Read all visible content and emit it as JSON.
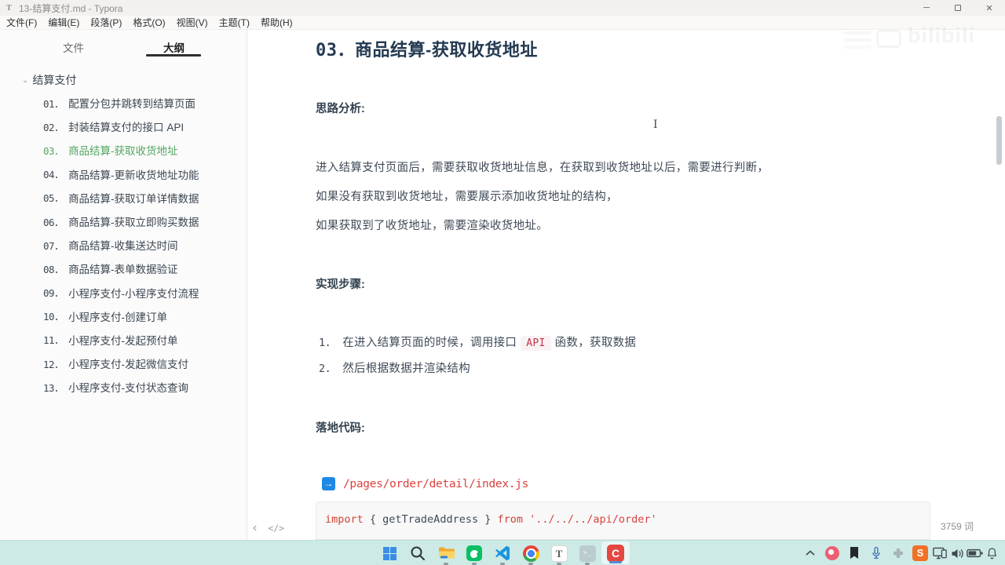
{
  "window": {
    "app_initial": "T",
    "title": "13-结算支付.md - Typora",
    "controls": {
      "minimize": "─",
      "close": "✕"
    }
  },
  "menu_bar": {
    "items": [
      {
        "label": "文件(F)"
      },
      {
        "label": "编辑(E)"
      },
      {
        "label": "段落(P)"
      },
      {
        "label": "格式(O)"
      },
      {
        "label": "视图(V)"
      },
      {
        "label": "主题(T)"
      },
      {
        "label": "帮助(H)"
      }
    ]
  },
  "sidebar": {
    "tabs": {
      "files": "文件",
      "outline": "大纲"
    },
    "active_tab": "大纲",
    "root": "结算支付",
    "root_chevron": "⌄",
    "items": [
      {
        "num": "01．",
        "label": "配置分包并跳转到结算页面"
      },
      {
        "num": "02．",
        "label": "封装结算支付的接口 API"
      },
      {
        "num": "03．",
        "label": "商品结算-获取收货地址"
      },
      {
        "num": "04．",
        "label": "商品结算-更新收货地址功能"
      },
      {
        "num": "05．",
        "label": "商品结算-获取订单详情数据"
      },
      {
        "num": "06．",
        "label": "商品结算-获取立即购买数据"
      },
      {
        "num": "07．",
        "label": "商品结算-收集送达时间"
      },
      {
        "num": "08．",
        "label": "商品结算-表单数据验证"
      },
      {
        "num": "09．",
        "label": "小程序支付-小程序支付流程"
      },
      {
        "num": "10．",
        "label": "小程序支付-创建订单"
      },
      {
        "num": "11．",
        "label": "小程序支付-发起预付单"
      },
      {
        "num": "12．",
        "label": "小程序支付-发起微信支付"
      },
      {
        "num": "13．",
        "label": "小程序支付-支付状态查询"
      }
    ],
    "active_index": 2
  },
  "document": {
    "heading_num": "03．",
    "heading_text": "商品结算-获取收货地址",
    "label_analysis": "思路分析:",
    "paragraphs": [
      "进入结算支付页面后，需要获取收货地址信息，在获取到收货地址以后，需要进行判断，",
      "如果没有获取到收货地址，需要展示添加收货地址的结构，",
      "如果获取到了收货地址，需要渲染收货地址。"
    ],
    "label_steps": "实现步骤:",
    "step1": {
      "num": "1．",
      "pre": "在进入结算页面的时候，调用接口",
      "code": "API",
      "post": "函数，获取数据"
    },
    "step2": {
      "num": "2．",
      "text": "然后根据数据并渲染结构"
    },
    "label_code": "落地代码:",
    "arrow_glyph": "→",
    "file_path": "/pages/order/detail/index.js",
    "code_tokens": {
      "kw1": "import",
      "plain": " { getTradeAddress } ",
      "kw2": "from",
      "str": " '../../../api/order'"
    },
    "footer": {
      "back_glyph": "‹",
      "source_mode_glyph": "</>",
      "word_count": "3759 词"
    },
    "watermark": "bilibili"
  },
  "taskbar": {
    "icons": [
      "windows-start",
      "search",
      "file-explorer",
      "wechat-devtools",
      "vscode",
      "chrome",
      "typora",
      "terminal",
      "screen-recorder-c"
    ],
    "typora_letter": "T",
    "terminal_glyph": ">_",
    "c_letter": "C",
    "tray": {
      "s_letter": "S",
      "icons": [
        "tray-expand",
        "red-app",
        "bookmark-app",
        "microphone",
        "gray-app",
        "sogou-input",
        "cast-display",
        "volume",
        "battery",
        "notification-bell"
      ]
    }
  },
  "colors": {
    "accent_green": "#55a561",
    "inline_code_red": "#c7344a",
    "path_red": "#d9433e",
    "arrow_blue": "#1e88e5",
    "taskbar_bg": "#cdeae6"
  }
}
